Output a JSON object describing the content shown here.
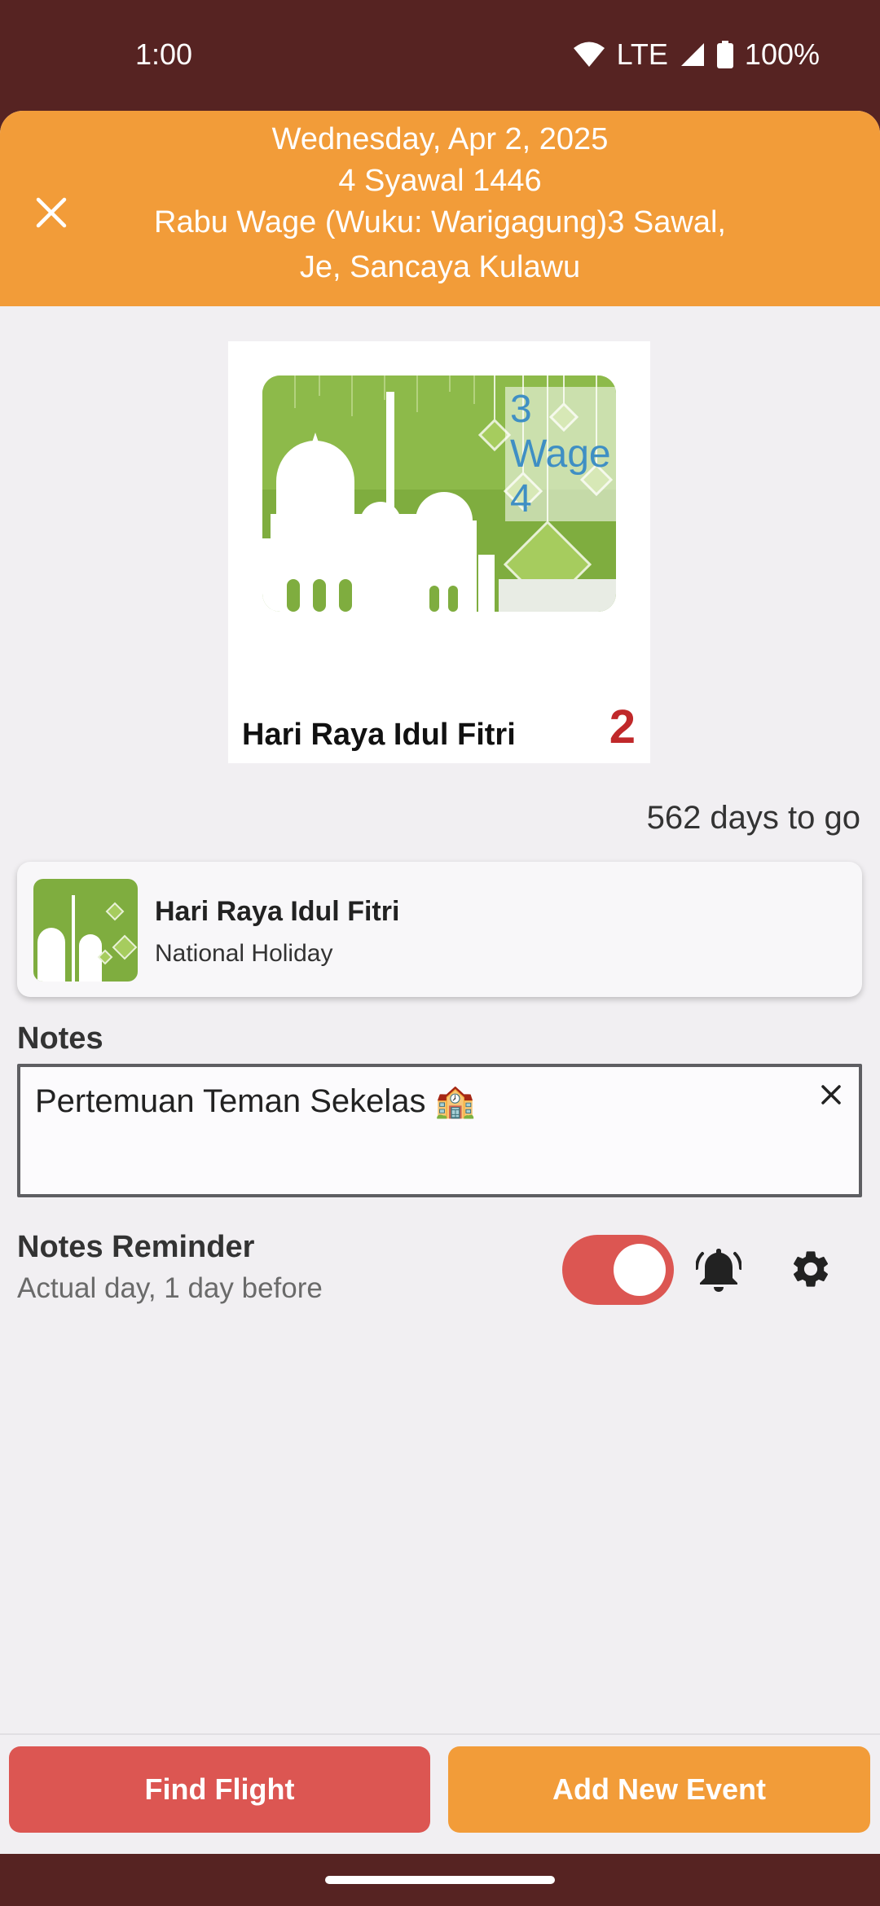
{
  "status_bar": {
    "time": "1:00",
    "network": "LTE",
    "battery": "100%"
  },
  "header": {
    "gregorian_date": "Wednesday, Apr 2, 2025",
    "hijri_date": "4 Syawal 1446",
    "javanese_line1": "Rabu Wage (Wuku: Warigagung)3 Sawal,",
    "javanese_line2": "Je, Sancaya Kulawu",
    "background_color": "#f29c39"
  },
  "holiday_card": {
    "pasaran_label": "3 Wage 4",
    "name": "Hari Raya Idul Fitri",
    "day_number": "2",
    "day_color": "#c0282a"
  },
  "countdown": "562 days to go",
  "event": {
    "title": "Hari Raya Idul Fitri",
    "category": "National Holiday"
  },
  "notes": {
    "label": "Notes",
    "value": "Pertemuan Teman Sekelas 🏫"
  },
  "reminder": {
    "title": "Notes Reminder",
    "subtitle": "Actual day, 1 day before",
    "enabled": true
  },
  "actions": {
    "find_flight": "Find Flight",
    "add_event": "Add New Event",
    "find_flight_color": "#dc5652",
    "add_event_color": "#f29c39"
  },
  "icons": {
    "close": "close-icon",
    "clear": "clear-icon",
    "bell": "bell-icon",
    "settings": "gear-icon",
    "wifi": "wifi-icon",
    "signal": "signal-icon",
    "battery": "battery-icon"
  }
}
